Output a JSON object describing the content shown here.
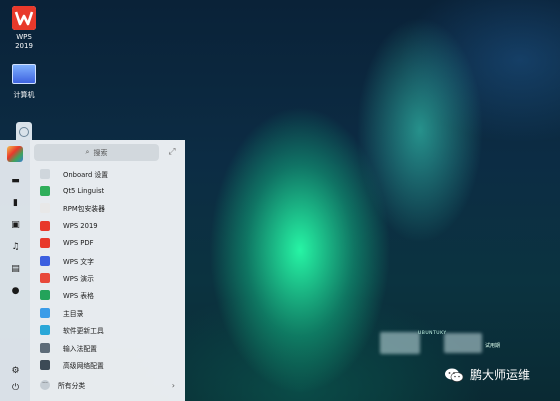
{
  "desktop": {
    "icons": [
      {
        "label_line1": "WPS",
        "label_line2": "2019",
        "icon": "wps-icon"
      },
      {
        "label_line1": "计算机",
        "icon": "computer-icon"
      }
    ]
  },
  "start_menu": {
    "search_placeholder": "搜索",
    "sidebar_icons": [
      "desktop-icon",
      "document-icon",
      "image-icon",
      "music-icon",
      "video-icon",
      "download-icon",
      "settings-icon",
      "power-icon"
    ],
    "items": [
      {
        "label": "Onboard 设置",
        "color": "#cfd6dc"
      },
      {
        "label": "Qt5 Linguist",
        "color": "#2fae5a"
      },
      {
        "label": "RPM包安装器",
        "color": "#e8e8e8"
      },
      {
        "label": "WPS 2019",
        "color": "#e8392b"
      },
      {
        "label": "WPS PDF",
        "color": "#e8392b"
      },
      {
        "label": "WPS 文字",
        "color": "#3c5fe0"
      },
      {
        "label": "WPS 演示",
        "color": "#e8493b"
      },
      {
        "label": "WPS 表格",
        "color": "#23a35a"
      },
      {
        "label": "主目录",
        "color": "#3a9ce8"
      },
      {
        "label": "软件更新工具",
        "color": "#2aa7d8"
      },
      {
        "label": "输入法配置",
        "color": "#5d6b78"
      },
      {
        "label": "高级网络配置",
        "color": "#3c4a56"
      }
    ],
    "all_categories": "所有分类"
  },
  "watermark": {
    "label": "鹏大师运维",
    "ubuntukylin": "UBUNTUKY",
    "trial": "试用期"
  }
}
